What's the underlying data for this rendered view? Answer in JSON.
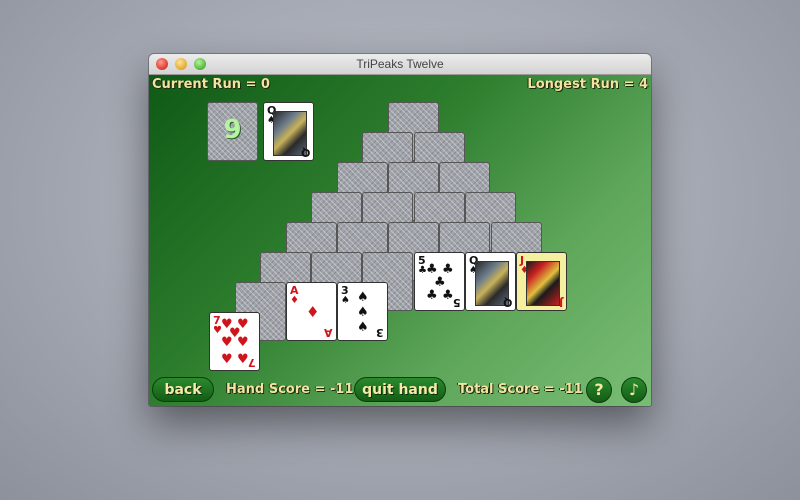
{
  "window": {
    "title": "TriPeaks Twelve"
  },
  "header": {
    "current_run": "Current Run = 0",
    "longest_run": "Longest Run = 4"
  },
  "stock": {
    "count": "9"
  },
  "waste": {
    "rank": "Q",
    "suit": "♠",
    "color": "black"
  },
  "footer": {
    "back_label": "back",
    "hand_score": "Hand Score = -11",
    "quit_label": "quit hand",
    "total_score": "Total Score = -11",
    "help_label": "?",
    "music_label": "♪"
  },
  "face_cards": [
    {
      "rank": "5",
      "suit": "♣",
      "color": "black"
    },
    {
      "rank": "Q",
      "suit": "♠",
      "color": "black"
    },
    {
      "rank": "J",
      "suit": "♦",
      "color": "red",
      "highlighted": true
    },
    {
      "rank": "A",
      "suit": "♦",
      "color": "red"
    },
    {
      "rank": "3",
      "suit": "♠",
      "color": "black"
    },
    {
      "rank": "7",
      "suit": "♥",
      "color": "red"
    }
  ]
}
